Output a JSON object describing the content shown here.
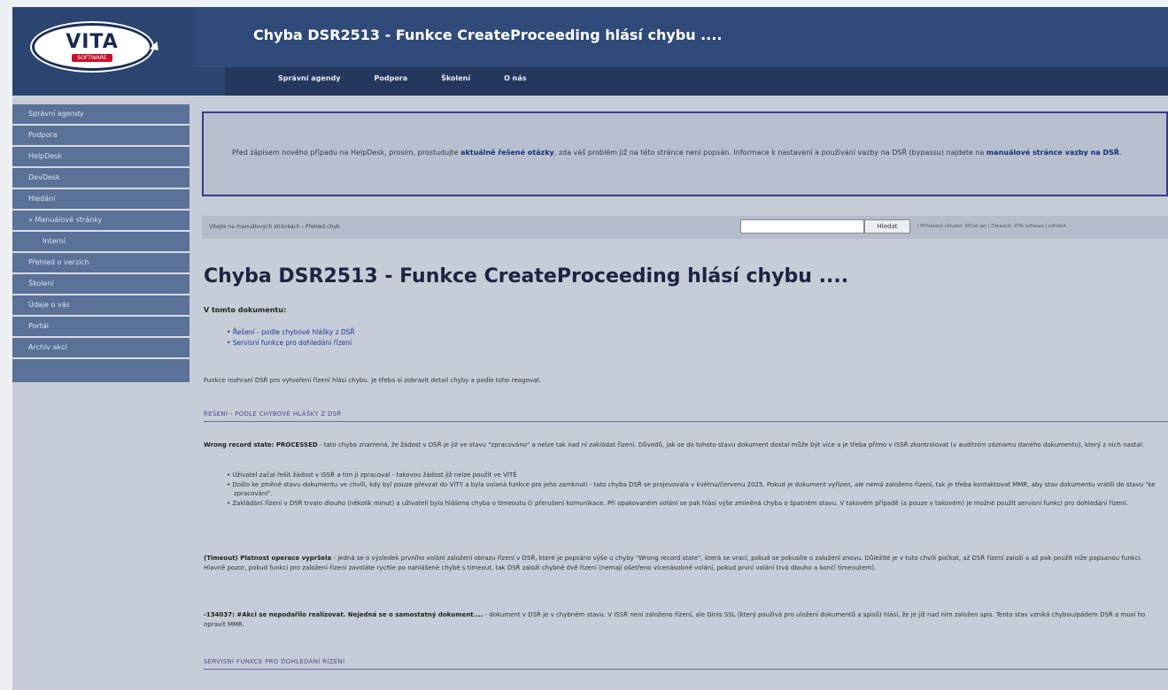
{
  "header": {
    "logo_text": "VITA",
    "logo_sub": "SOFTWARE",
    "page_title": "Chyba DSR2513 - Funkce CreateProceeding hlásí chybu ...."
  },
  "topnav": [
    "Správní agendy",
    "Podpora",
    "Školení",
    "O nás"
  ],
  "sidebar": [
    {
      "label": "Správní agendy",
      "indent": false
    },
    {
      "label": "Podpora",
      "indent": false
    },
    {
      "label": "HelpDesk",
      "indent": false
    },
    {
      "label": "DevDesk",
      "indent": false
    },
    {
      "label": "Hledání",
      "indent": false
    },
    {
      "label": "» Manuálové stránky",
      "indent": false
    },
    {
      "label": "Interní",
      "indent": true
    },
    {
      "label": "Přehled o verzích",
      "indent": false
    },
    {
      "label": "Školení",
      "indent": false
    },
    {
      "label": "Údaje o vás",
      "indent": false
    },
    {
      "label": "Portál",
      "indent": false
    },
    {
      "label": "Archiv akcí",
      "indent": false
    }
  ],
  "notice": {
    "p1": "Před zápisem nového případu na HelpDesk, prosím, prostudujte ",
    "link1": "aktuálně řešené otázky",
    "p2": ", zda váš problém již na této stránce není popsán. Informace k nastavení a používání vazby na DSŘ (bypassu) najdete na ",
    "link2": "manuálové stránce vazby na DSŘ",
    "p3": "."
  },
  "crumb": "Vítejte na manuálových stránkách › Přehled chyb",
  "search": {
    "button": "Hledat",
    "placeholder": ""
  },
  "user_info": "| Přihlášený uživatel: Kříček Jan | Zákazník: VITA software | odhlásit",
  "doc": {
    "title": "Chyba DSR2513 - Funkce CreateProceeding hlásí chybu ....",
    "toc_heading": "V tomto dokumentu:",
    "toc": [
      "Řešení - podle chybové hlášky z DSŘ",
      "Servisní funkce pro dohledání řízení"
    ],
    "intro": "Funkce rozhraní DSŘ pro vytvoření řízení hlásí chybu. Je třeba si zobrazit detail chyby a podle toho reagovat.",
    "section1": "ŘEŠENÍ - PODLE CHYBOVÉ HLÁŠKY Z DSŘ",
    "para1_bold": "Wrong record state: PROCESSED",
    "para1": " - tato chyba znamená, že žádost v DSŘ je již ve stavu \"zpracováno\" a nelze tak nad ní zakládat řízení. Důvodů, jak se do tohoto stavu dokument dostal může být více a je třeba přímo v ISSŘ zkontrolovat (v auditním záznamu daného dokumentu), který z nich nastal:",
    "bullets": [
      "Uživatel začal řešit žádost v ISSŘ a tím ji zpracoval - takovou žádost již nelze použít ve VITĚ",
      "Došlo ke změně stavu dokumentu ve chvíli, kdy byl pouze převzat do VITY a byla volaná funkce pro jeho zamknutí - tato chyba DSŘ se projevovala v květnu/červenu 2025. Pokud je dokument vyřízen, ale nemá založeno řízení, tak je třeba kontaktovat MMR, aby stav dokumentu vrátili do stavu \"ke zpracování\".",
      "Zakládání řízení v DSŘ trvalo dlouho (několik minut) a uživateli byla hlášena chyba o timeoutu či přerušení komunikace. Při opakovaném volání se pak hlásí výše zmíněná chyba o špatném stavu. V takovém případě (a pouze v takovém) je možné použít servisní funkci pro dohledání řízení."
    ],
    "para2_bold": "(Timeout) Platnost operace vypršela",
    "para2": " - jedná se o výsledek prvního volání založení obrazu řízení v DSŘ, které je popsáno výše u chyby \"Wrong record state\", která se vrací, pokud se pokusíte o založení znovu. Důležité je v tuto chvíli počkat, až DSŘ řízení založí a až pak použít níže popsanou funkci. Hlavně pozor, pokud funkci pro založení řízení zavoláte rychle po nahlášené chybě s timeout, tak DSŘ založí chybně dvě řízení (nemají ošetřeno vícenásobné volání, pokud první volání trvá dlouho a končí timeoutem).",
    "para3_bold": "-134037: #Akci se nepodařilo realizovat. Nejedná se o samostatný dokument....",
    "para3": " - dokument v DSŘ je v chybném stavu. V ISSŘ není založeno řízení, ale Ginis SSL (který používá pro uložení dokumentů a spisů) hlásí, že je již nad ním založen spis. Tento stav vzniká chybou/pádem DSŘ a musí ho opravit MMR.",
    "section2": "SERVISNÍ FUNKCE PRO DOHLEDÁNÍ ŘÍZENÍ"
  }
}
